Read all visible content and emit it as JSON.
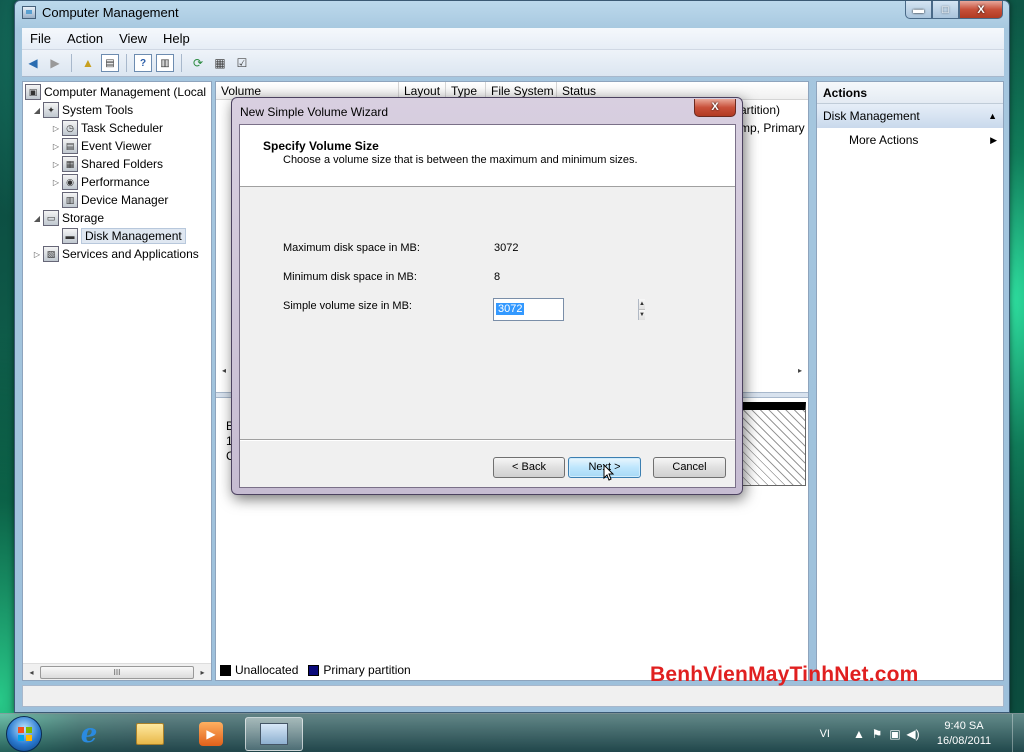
{
  "window": {
    "title": "Computer Management",
    "controls": {
      "minimize": "▬",
      "maximize": "□",
      "close": "X"
    }
  },
  "menu": [
    "File",
    "Action",
    "View",
    "Help"
  ],
  "tree": [
    {
      "label": "Computer Management (Local",
      "level": 0,
      "expander": "",
      "icon": "computer-icon"
    },
    {
      "label": "System Tools",
      "level": 1,
      "expander": "◢",
      "icon": "tools-icon"
    },
    {
      "label": "Task Scheduler",
      "level": 2,
      "expander": "▷",
      "icon": "clock-icon"
    },
    {
      "label": "Event Viewer",
      "level": 2,
      "expander": "▷",
      "icon": "event-viewer-icon"
    },
    {
      "label": "Shared Folders",
      "level": 2,
      "expander": "▷",
      "icon": "shared-folder-icon"
    },
    {
      "label": "Performance",
      "level": 2,
      "expander": "▷",
      "icon": "performance-icon"
    },
    {
      "label": "Device Manager",
      "level": 2,
      "expander": "",
      "icon": "device-manager-icon"
    },
    {
      "label": "Storage",
      "level": 1,
      "expander": "◢",
      "icon": "storage-icon"
    },
    {
      "label": "Disk Management",
      "level": 2,
      "expander": "",
      "icon": "disk-icon",
      "selected": true
    },
    {
      "label": "Services and Applications",
      "level": 1,
      "expander": "▷",
      "icon": "services-icon"
    }
  ],
  "tree_scroll": {
    "left": "◂",
    "thumb": "III",
    "right": "▸"
  },
  "volume_table": {
    "columns": [
      "Volume",
      "Layout",
      "Type",
      "File System",
      "Status"
    ],
    "visible_fragments": [
      "artition)",
      "mp, Primary"
    ]
  },
  "disk_area_fragments": [
    "B",
    "1",
    "C"
  ],
  "legend": [
    {
      "label": "Unallocated",
      "color": "#000000"
    },
    {
      "label": "Primary partition",
      "color": "#0a0a7a"
    }
  ],
  "actions": {
    "title": "Actions",
    "section": "Disk Management",
    "section_caret": "▲",
    "more": "More Actions",
    "more_caret": "▶"
  },
  "wizard": {
    "title": "New Simple Volume Wizard",
    "close": "X",
    "heading": "Specify Volume Size",
    "description": "Choose a volume size that is between the maximum and minimum sizes.",
    "max_label": "Maximum disk space in MB:",
    "max_value": "3072",
    "min_label": "Minimum disk space in MB:",
    "min_value": "8",
    "size_label": "Simple volume size in MB:",
    "size_value": "3072",
    "back": "< Back",
    "next": "Next >",
    "cancel": "Cancel"
  },
  "watermark": "BenhVienMayTinhNet.com",
  "taskbar": {
    "ie_glyph": "e",
    "media_glyph": "▶",
    "language": "VI",
    "tray_icons": [
      "▲",
      "⚑",
      "▣",
      "◀)"
    ],
    "time": "9:40 SA",
    "date": "16/08/2011"
  },
  "colors": {
    "accent": "#3399ff",
    "watermark": "#e02020",
    "title_close": "#c7503a"
  }
}
